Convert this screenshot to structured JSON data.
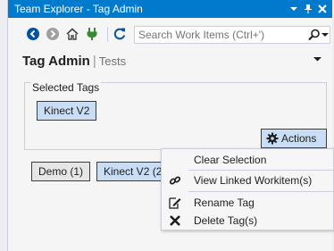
{
  "window": {
    "title": "Team Explorer - Tag Admin",
    "controls": [
      "chevron-down-icon",
      "pin-icon",
      "close-icon"
    ]
  },
  "toolbar": {
    "buttons": [
      "back-icon",
      "forward-icon",
      "home-icon",
      "connect-icon",
      "refresh-icon"
    ]
  },
  "search": {
    "placeholder": "Search Work Items (Ctrl+')"
  },
  "header": {
    "title": "Tag Admin",
    "separator": "|",
    "subtitle": "Tests"
  },
  "selected_tags": {
    "legend": "Selected Tags",
    "tags": [
      "Kinect V2"
    ]
  },
  "actions": {
    "label": "Actions"
  },
  "tag_list": [
    {
      "label": "Demo (1)",
      "selected": false
    },
    {
      "label": "Kinect V2 (2",
      "selected": true
    }
  ],
  "context_menu": {
    "items": [
      {
        "label": "Clear Selection",
        "icon": ""
      },
      {
        "label": "View Linked Workitem(s)",
        "icon": "link-icon"
      },
      {
        "label": "Rename Tag",
        "icon": "rename-icon"
      },
      {
        "label": "Delete Tag(s)",
        "icon": "delete-icon"
      }
    ]
  },
  "colors": {
    "accent": "#007acc",
    "tag_selected": "#c9def5",
    "tag_unselected": "#e6e6e6",
    "panel_bg": "#f5f5f5"
  }
}
